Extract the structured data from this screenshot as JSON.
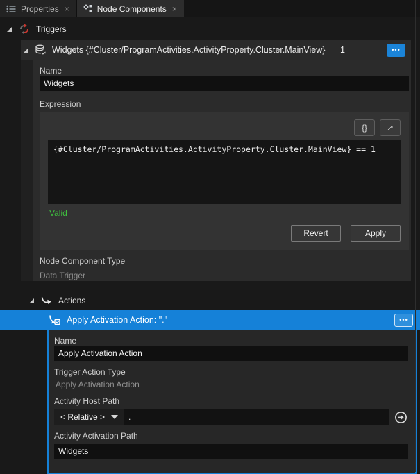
{
  "tabs": [
    {
      "label": "Properties"
    },
    {
      "label": "Node Components"
    }
  ],
  "ui": {
    "close_glyph": "×",
    "ellipsis": "•••"
  },
  "triggers_section": {
    "label": "Triggers"
  },
  "trigger": {
    "title": "Widgets {#Cluster/ProgramActivities.ActivityProperty.Cluster.MainView} == 1",
    "name_label": "Name",
    "name_value": "Widgets",
    "expression_label": "Expression",
    "braces_button": "{}",
    "open_button": "↗",
    "expression_value": "{#Cluster/ProgramActivities.ActivityProperty.Cluster.MainView} == 1",
    "status": "Valid",
    "revert_label": "Revert",
    "apply_label": "Apply",
    "type_label": "Node Component Type",
    "type_value": "Data Trigger"
  },
  "actions_section": {
    "label": "Actions"
  },
  "action": {
    "title": "Apply Activation Action: \".\"",
    "name_label": "Name",
    "name_value": "Apply Activation Action",
    "type_label": "Trigger Action Type",
    "type_value": "Apply Activation Action",
    "host_path_label": "Activity Host Path",
    "host_path_mode": "< Relative >",
    "host_path_value": ".",
    "activation_path_label": "Activity Activation Path",
    "activation_path_value": "Widgets"
  },
  "colors": {
    "accent": "#1581d8",
    "valid": "#3fbf3f",
    "selection": "#1581d8"
  }
}
